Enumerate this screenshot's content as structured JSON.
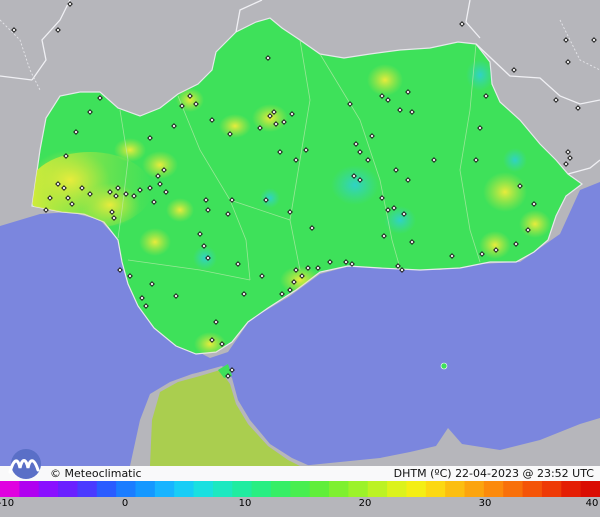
{
  "map": {
    "brand": "Meteoclimatic",
    "caption": "DHTM (ºC)  22-04-2023 @ 23:52 UTC",
    "colors": {
      "land_gray": "#b6b6bb",
      "sea": "#7b86de",
      "region_green": "#3ee15a",
      "warm_yellow": "#c4e63c",
      "cool_cyan": "#36d7b0",
      "border_white": "#e8e8ec"
    },
    "scale": {
      "ticks": [
        "-10",
        "0",
        "10",
        "20",
        "30",
        "40"
      ],
      "min": -10,
      "max": 40,
      "colors": [
        "#e000e0",
        "#b000f0",
        "#8a10ff",
        "#6a20ff",
        "#4a3aff",
        "#2a5cff",
        "#1b7dff",
        "#1598ff",
        "#18b4ff",
        "#18cdf6",
        "#1ae0e0",
        "#1de8c0",
        "#20eca0",
        "#28ee82",
        "#36ee66",
        "#48ee50",
        "#60ee3a",
        "#7ef030",
        "#9cf22a",
        "#bcf224",
        "#dcf21c",
        "#f4ee14",
        "#fcd812",
        "#fcbe10",
        "#fca40e",
        "#fc8a0c",
        "#f8700a",
        "#f45408",
        "#ee3a06",
        "#e41e04",
        "#da0c02"
      ]
    },
    "icons": {
      "logo": "meteoclimatic-logo",
      "copyright": "copyright-icon",
      "station": "station-marker"
    }
  }
}
